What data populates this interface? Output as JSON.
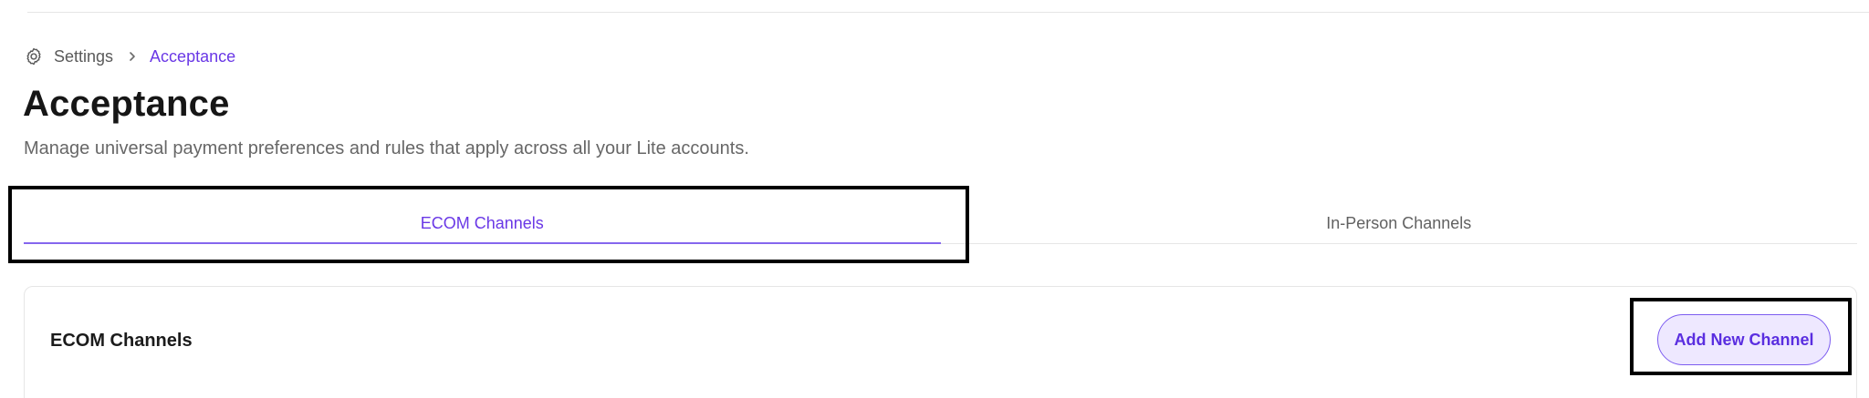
{
  "breadcrumb": {
    "icon": "gear-icon",
    "root_label": "Settings",
    "separator_icon": "chevron-right-icon",
    "current_label": "Acceptance"
  },
  "header": {
    "title": "Acceptance",
    "subtitle": "Manage universal payment preferences and rules that apply across all your Lite accounts."
  },
  "tabs": [
    {
      "label": "ECOM Channels",
      "active": true
    },
    {
      "label": "In-Person Channels",
      "active": false
    }
  ],
  "card": {
    "title": "ECOM Channels",
    "add_button_label": "Add New Channel"
  },
  "colors": {
    "accent": "#6a38e6",
    "accent_light_bg": "#eee8ff",
    "text_muted": "#676767",
    "border": "#e6e6e6"
  }
}
